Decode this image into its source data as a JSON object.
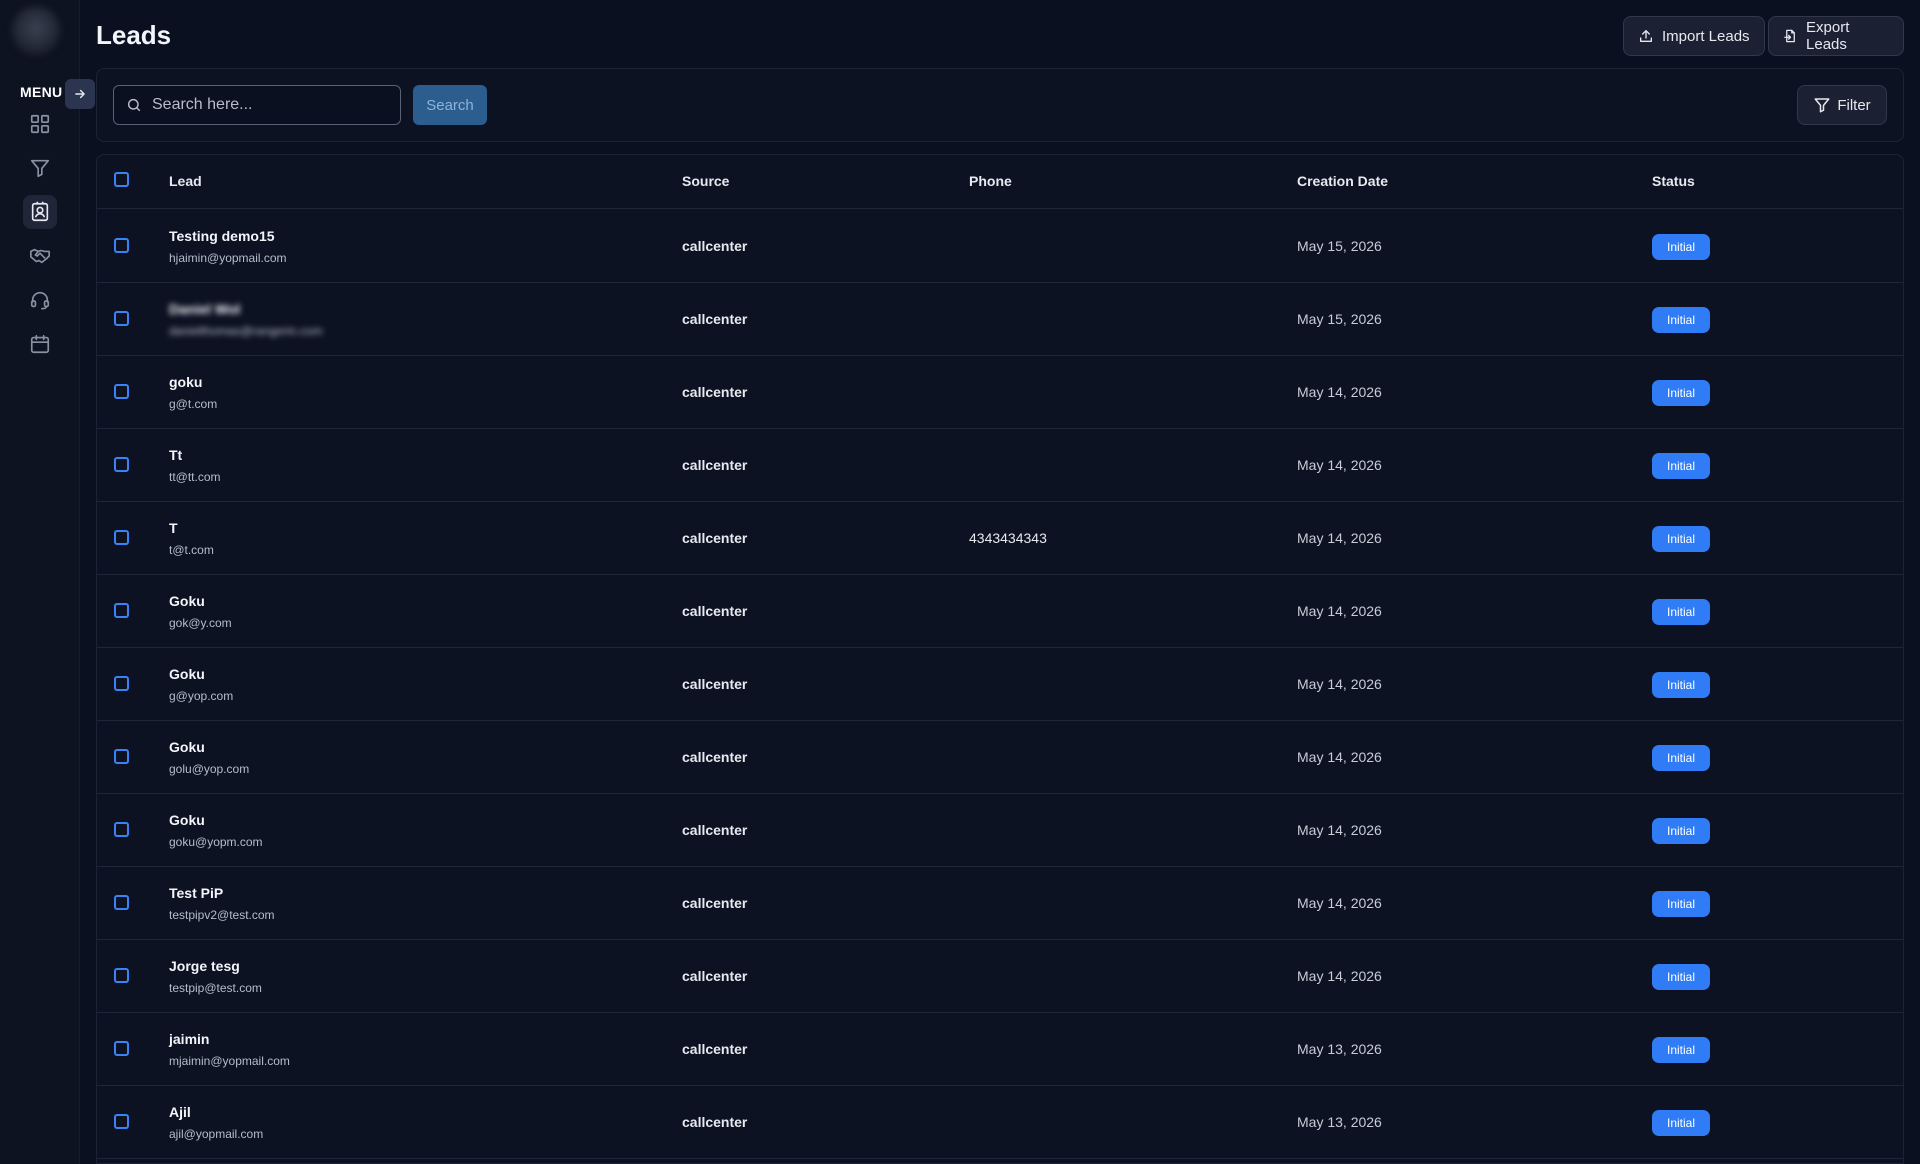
{
  "sidebar": {
    "menu_label": "MENU",
    "nav_icons": [
      "grid-icon",
      "funnel-icon",
      "contact-card-icon",
      "handshake-icon",
      "headset-icon",
      "calendar-icon"
    ],
    "active_index": 2
  },
  "header": {
    "title": "Leads",
    "import_label": "Import Leads",
    "export_label": "Export Leads"
  },
  "search": {
    "placeholder": "Search here...",
    "button_label": "Search",
    "filter_label": "Filter"
  },
  "table": {
    "columns": [
      "Lead",
      "Source",
      "Phone",
      "Creation Date",
      "Status"
    ],
    "rows": [
      {
        "name": "Testing demo15",
        "email": "hjaimin@yopmail.com",
        "source": "callcenter",
        "phone": "",
        "date": "May 15, 2026",
        "status": "Initial"
      },
      {
        "name": "Daniel Wol",
        "email": "danielthomas@rangerin.com",
        "source": "callcenter",
        "phone": "",
        "date": "May 15, 2026",
        "status": "Initial",
        "blurred": true
      },
      {
        "name": "goku",
        "email": "g@t.com",
        "source": "callcenter",
        "phone": "",
        "date": "May 14, 2026",
        "status": "Initial"
      },
      {
        "name": "Tt",
        "email": "tt@tt.com",
        "source": "callcenter",
        "phone": "",
        "date": "May 14, 2026",
        "status": "Initial"
      },
      {
        "name": "T",
        "email": "t@t.com",
        "source": "callcenter",
        "phone": "4343434343",
        "date": "May 14, 2026",
        "status": "Initial"
      },
      {
        "name": "Goku",
        "email": "gok@y.com",
        "source": "callcenter",
        "phone": "",
        "date": "May 14, 2026",
        "status": "Initial"
      },
      {
        "name": "Goku",
        "email": "g@yop.com",
        "source": "callcenter",
        "phone": "",
        "date": "May 14, 2026",
        "status": "Initial"
      },
      {
        "name": "Goku",
        "email": "golu@yop.com",
        "source": "callcenter",
        "phone": "",
        "date": "May 14, 2026",
        "status": "Initial"
      },
      {
        "name": "Goku",
        "email": "goku@yopm.com",
        "source": "callcenter",
        "phone": "",
        "date": "May 14, 2026",
        "status": "Initial"
      },
      {
        "name": "Test PiP",
        "email": "testpipv2@test.com",
        "source": "callcenter",
        "phone": "",
        "date": "May 14, 2026",
        "status": "Initial"
      },
      {
        "name": "Jorge tesg",
        "email": "testpip@test.com",
        "source": "callcenter",
        "phone": "",
        "date": "May 14, 2026",
        "status": "Initial"
      },
      {
        "name": "jaimin",
        "email": "mjaimin@yopmail.com",
        "source": "callcenter",
        "phone": "",
        "date": "May 13, 2026",
        "status": "Initial"
      },
      {
        "name": "Ajil",
        "email": "ajil@yopmail.com",
        "source": "callcenter",
        "phone": "",
        "date": "May 13, 2026",
        "status": "Initial"
      }
    ]
  },
  "colors": {
    "accent": "#2f7cf6",
    "background": "#0b1020"
  }
}
